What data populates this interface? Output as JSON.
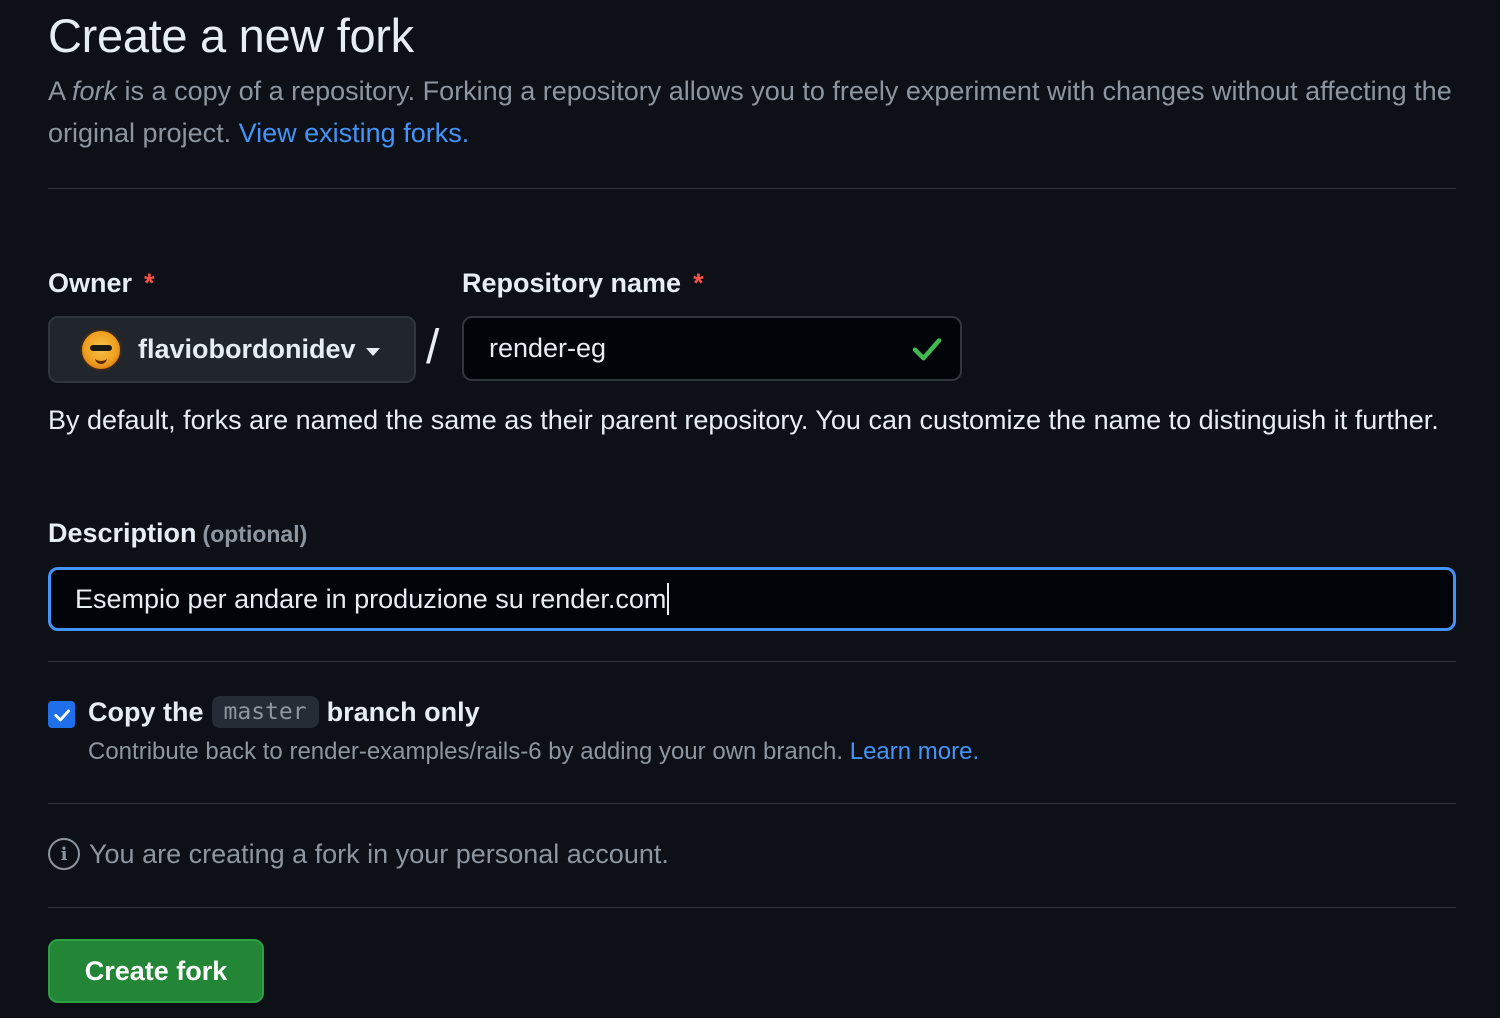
{
  "header": {
    "title": "Create a new fork",
    "subtitle_pre": "A ",
    "subtitle_em": "fork",
    "subtitle_post": " is a copy of a repository. Forking a repository allows you to freely experiment with changes without affecting the original project. ",
    "view_forks_link": "View existing forks."
  },
  "owner": {
    "label": "Owner",
    "required_mark": "*",
    "value": "flaviobordonidev"
  },
  "separator": "/",
  "repository": {
    "label": "Repository name",
    "required_mark": "*",
    "value": "render-eg",
    "status_icon": "check-icon"
  },
  "help_text": "By default, forks are named the same as their parent repository. You can customize the name to distinguish it further.",
  "description": {
    "label": "Description",
    "optional": "(optional)",
    "value": "Esempio per andare in produzione su render.com"
  },
  "copy_branch": {
    "checked": true,
    "label_pre": "Copy the",
    "branch": "master",
    "label_post": "branch only",
    "note": "Contribute back to render-examples/rails-6 by adding your own branch. ",
    "learn_more": "Learn more."
  },
  "info": {
    "icon": "info-icon",
    "text": "You are creating a fork in your personal account."
  },
  "actions": {
    "create_label": "Create fork"
  },
  "colors": {
    "background": "#0d1117",
    "accent": "#4493f8",
    "primary_button": "#238636",
    "success": "#3fb950",
    "danger": "#f85149"
  }
}
